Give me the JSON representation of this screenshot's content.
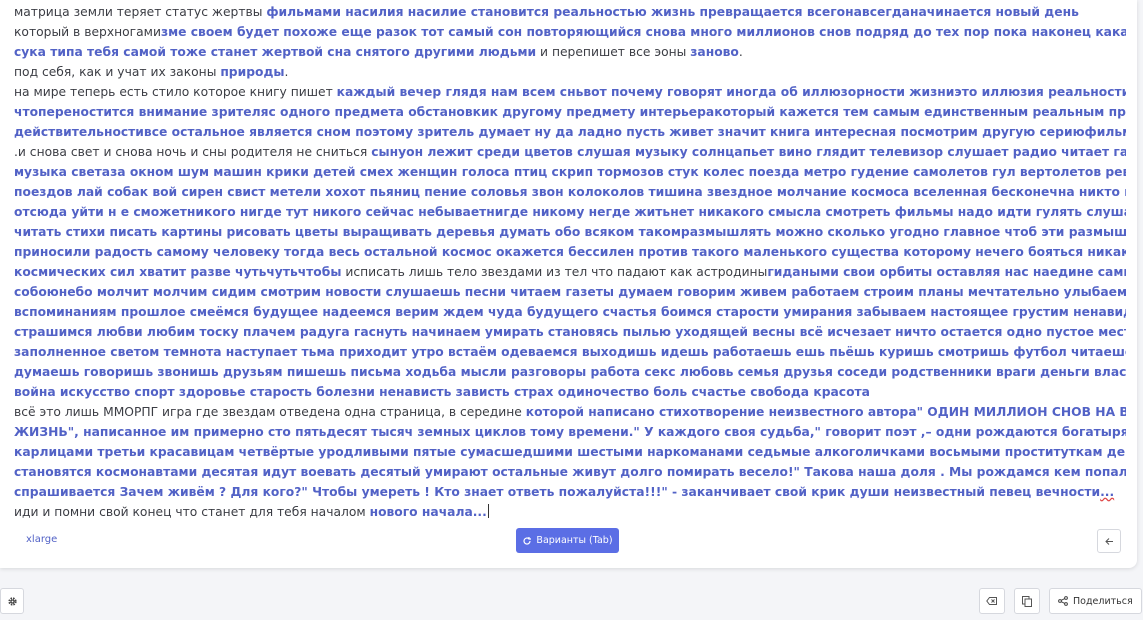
{
  "editor": {
    "paragraphs": [
      [
        [
          "матрица земли теряет статус жертвы ",
          false
        ],
        [
          "фильмами насилия насилие становится реальностью жизнь превращается всегонавсегданачинается новый день",
          true
        ]
      ],
      [
        [
          " который в верхногами",
          false
        ],
        [
          "зме своем будет похоже еще разок тот самый сон повторяющийся снова много миллионов снов подряд до тех пор пока наконец какая нибудь",
          true
        ]
      ],
      [
        [
          "сука типа тебя самой тоже станет жертвой сна снятого другими людьми",
          true
        ],
        [
          " и перепишет все эоны ",
          false
        ],
        [
          "заново",
          true
        ],
        [
          ".",
          false
        ]
      ],
      [
        [
          "под себя, как и учат их законы ",
          false
        ],
        [
          "природы",
          true
        ],
        [
          ".",
          false
        ]
      ],
      [
        [
          "на мире теперь есть стило которое книгу пишет ",
          false
        ],
        [
          "каждый вечер глядя нам всем сньвот почему говорят иногда об иллюзорности жизниэто иллюзия реальностипотому",
          true
        ]
      ],
      [
        [
          "чтопереностится внимание зрителяс одного предмета обстановкик другому предмету интерьеракоторый кажется тем самым единственным реальным предметом",
          true
        ]
      ],
      [
        [
          "действительностивсе остальное является сном поэтому зритель думает ну да ладно пусть живет значит книга интересная посмотрим другую сериюфильм кончился",
          true
        ]
      ],
      [
        [
          ".и снова свет и снова ночь и сны родителя не сниться ",
          false
        ],
        [
          "сынуон лежит среди цветов слушая музыку солнцапьет вино глядит телевизор слушает радио читает газету играет",
          true
        ]
      ],
      [
        [
          "музыка светаза окном шум машин крики детей смех женщин голоса птиц скрип тормозов стук колес поезда метро гудение самолетов гул вертолетов рев моторов",
          true
        ]
      ],
      [
        [
          "поездов лай собак вой сирен свист метели хохот пьяниц пение соловья звон колоколов тишина звездное молчание космоса вселенная бесконечна никто никуда",
          true
        ]
      ],
      [
        [
          "отсюда уйти н е сможетникого нигде тут никого сейчас небываетнигде никому негде житьнет никакого смысла смотреть фильмы надо идти гулять слушать тишину",
          true
        ]
      ],
      [
        [
          "читать стихи писать картины рисовать цветы выращивать деревья думать обо всяком такомразмышлять можно сколько угодно главное чтоб эти размышления",
          true
        ]
      ],
      [
        [
          "приносили радость самому человеку тогда весь остальной космос окажется бессилен против такого маленького существа которому нечего бояться никаких",
          true
        ]
      ],
      [
        [
          "космических сил хватит разве чутьчутьчтобы",
          true
        ],
        [
          " исписать лишь тело звездами из тел что падают как астродины",
          false
        ],
        [
          "гидаными свои орбиты оставляя нас наедине самим",
          true
        ]
      ],
      [
        [
          "собоюнебо молчит молчим сидим смотрим новости слушаешь песни читаем газеты думаем говорим живем работаем строим планы мечтательно улыбаемся",
          true
        ]
      ],
      [
        [
          "вспоминаниям прошлое смеёмся будущее надеемся верим ждем чуда будущего счастья боимся старости умирания забываем настоящее грустим ненавидим",
          true
        ]
      ],
      [
        [
          "страшимся любви любим тоску плачем радуга гаснуть начинаем умирать становясь пылью уходящей весны всё исчезает ничто остается одно пустое место",
          true
        ]
      ],
      [
        [
          "заполненное светом темнота наступает тьма приходит утро встаём одеваемся выходишь идешь работаешь ешь пьёшь куришь смотришь футбол читаешся спишь",
          true
        ]
      ],
      [
        [
          "думаешь говоришь звонишь друзьям пишешь письма ходьба мысли разговоры работа секс любовь семья друзья соседи родственники враги деньги власть политика",
          true
        ]
      ],
      [
        [
          "война искусство спорт здоровье старость болезни ненависть зависть страх одиночество боль счастье свобода красота",
          true
        ]
      ],
      [
        [
          "всё это лишь ММОРПГ игра где звездам отведена одна страница, в середине ",
          false
        ],
        [
          "которой написано стихотворение неизвестного автора\" ОДИН МИЛЛИОН СНОВ НА ВСЮ",
          true
        ]
      ],
      [
        [
          "ЖИЗНЬ\", написанное им примерно сто пятьдесят тысяч земных циклов тому времени.\" У каждого своя судьба,\" говорит поэт ,– одни рождаются богатырями другие",
          true
        ]
      ],
      [
        [
          "карлицами третьи красавицам четвёртые уродливыми пятые сумасшедшими шестыми наркоманами седьмые алкоголичками восьмыми проституткам девятая",
          true
        ]
      ],
      [
        [
          "становятся космонавтами десятая идут воевать десятый умирают остальные живут долго помирать весело!\" Такова наша доля . Мы рождамся кем попало зачем",
          true
        ]
      ],
      [
        [
          "спрашивается Зачем живём ? Для кого?\" Чтобы умереть ! Кто знает ответь пожалуйста!!!\" - заканчивает свой крик души неизвестный певец вечности",
          true
        ],
        [
          "...",
          "dots"
        ]
      ],
      [
        [
          "иди и помни свой конец что станет для тебя началом ",
          false
        ],
        [
          "нового начала...",
          true
        ],
        [
          "",
          "cursor"
        ]
      ]
    ]
  },
  "footer": {
    "size_label": "xlarge",
    "variants_label": "Варианты (Tab)",
    "share_label": "Поделиться"
  },
  "icons": {
    "variants": "refresh-icon",
    "back": "arrow-left-icon",
    "settings": "gear-icon",
    "clear": "eraser-icon",
    "copy": "copy-icon",
    "share": "share-icon"
  },
  "colors": {
    "accent": "#5262c6",
    "button": "#5b6ee5",
    "text": "#3b3d44",
    "background": "#f4f5f8"
  }
}
